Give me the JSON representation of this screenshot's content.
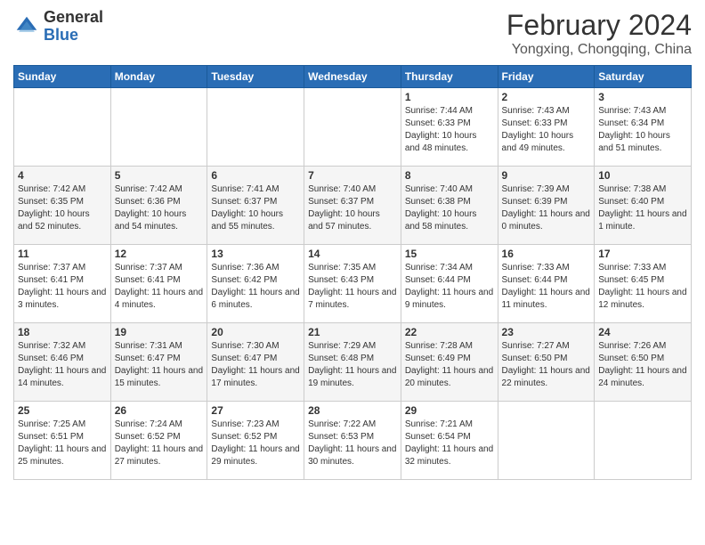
{
  "logo": {
    "general": "General",
    "blue": "Blue"
  },
  "title": "February 2024",
  "location": "Yongxing, Chongqing, China",
  "days_header": [
    "Sunday",
    "Monday",
    "Tuesday",
    "Wednesday",
    "Thursday",
    "Friday",
    "Saturday"
  ],
  "weeks": [
    [
      {
        "day": "",
        "info": ""
      },
      {
        "day": "",
        "info": ""
      },
      {
        "day": "",
        "info": ""
      },
      {
        "day": "",
        "info": ""
      },
      {
        "day": "1",
        "info": "Sunrise: 7:44 AM\nSunset: 6:33 PM\nDaylight: 10 hours and 48 minutes."
      },
      {
        "day": "2",
        "info": "Sunrise: 7:43 AM\nSunset: 6:33 PM\nDaylight: 10 hours and 49 minutes."
      },
      {
        "day": "3",
        "info": "Sunrise: 7:43 AM\nSunset: 6:34 PM\nDaylight: 10 hours and 51 minutes."
      }
    ],
    [
      {
        "day": "4",
        "info": "Sunrise: 7:42 AM\nSunset: 6:35 PM\nDaylight: 10 hours and 52 minutes."
      },
      {
        "day": "5",
        "info": "Sunrise: 7:42 AM\nSunset: 6:36 PM\nDaylight: 10 hours and 54 minutes."
      },
      {
        "day": "6",
        "info": "Sunrise: 7:41 AM\nSunset: 6:37 PM\nDaylight: 10 hours and 55 minutes."
      },
      {
        "day": "7",
        "info": "Sunrise: 7:40 AM\nSunset: 6:37 PM\nDaylight: 10 hours and 57 minutes."
      },
      {
        "day": "8",
        "info": "Sunrise: 7:40 AM\nSunset: 6:38 PM\nDaylight: 10 hours and 58 minutes."
      },
      {
        "day": "9",
        "info": "Sunrise: 7:39 AM\nSunset: 6:39 PM\nDaylight: 11 hours and 0 minutes."
      },
      {
        "day": "10",
        "info": "Sunrise: 7:38 AM\nSunset: 6:40 PM\nDaylight: 11 hours and 1 minute."
      }
    ],
    [
      {
        "day": "11",
        "info": "Sunrise: 7:37 AM\nSunset: 6:41 PM\nDaylight: 11 hours and 3 minutes."
      },
      {
        "day": "12",
        "info": "Sunrise: 7:37 AM\nSunset: 6:41 PM\nDaylight: 11 hours and 4 minutes."
      },
      {
        "day": "13",
        "info": "Sunrise: 7:36 AM\nSunset: 6:42 PM\nDaylight: 11 hours and 6 minutes."
      },
      {
        "day": "14",
        "info": "Sunrise: 7:35 AM\nSunset: 6:43 PM\nDaylight: 11 hours and 7 minutes."
      },
      {
        "day": "15",
        "info": "Sunrise: 7:34 AM\nSunset: 6:44 PM\nDaylight: 11 hours and 9 minutes."
      },
      {
        "day": "16",
        "info": "Sunrise: 7:33 AM\nSunset: 6:44 PM\nDaylight: 11 hours and 11 minutes."
      },
      {
        "day": "17",
        "info": "Sunrise: 7:33 AM\nSunset: 6:45 PM\nDaylight: 11 hours and 12 minutes."
      }
    ],
    [
      {
        "day": "18",
        "info": "Sunrise: 7:32 AM\nSunset: 6:46 PM\nDaylight: 11 hours and 14 minutes."
      },
      {
        "day": "19",
        "info": "Sunrise: 7:31 AM\nSunset: 6:47 PM\nDaylight: 11 hours and 15 minutes."
      },
      {
        "day": "20",
        "info": "Sunrise: 7:30 AM\nSunset: 6:47 PM\nDaylight: 11 hours and 17 minutes."
      },
      {
        "day": "21",
        "info": "Sunrise: 7:29 AM\nSunset: 6:48 PM\nDaylight: 11 hours and 19 minutes."
      },
      {
        "day": "22",
        "info": "Sunrise: 7:28 AM\nSunset: 6:49 PM\nDaylight: 11 hours and 20 minutes."
      },
      {
        "day": "23",
        "info": "Sunrise: 7:27 AM\nSunset: 6:50 PM\nDaylight: 11 hours and 22 minutes."
      },
      {
        "day": "24",
        "info": "Sunrise: 7:26 AM\nSunset: 6:50 PM\nDaylight: 11 hours and 24 minutes."
      }
    ],
    [
      {
        "day": "25",
        "info": "Sunrise: 7:25 AM\nSunset: 6:51 PM\nDaylight: 11 hours and 25 minutes."
      },
      {
        "day": "26",
        "info": "Sunrise: 7:24 AM\nSunset: 6:52 PM\nDaylight: 11 hours and 27 minutes."
      },
      {
        "day": "27",
        "info": "Sunrise: 7:23 AM\nSunset: 6:52 PM\nDaylight: 11 hours and 29 minutes."
      },
      {
        "day": "28",
        "info": "Sunrise: 7:22 AM\nSunset: 6:53 PM\nDaylight: 11 hours and 30 minutes."
      },
      {
        "day": "29",
        "info": "Sunrise: 7:21 AM\nSunset: 6:54 PM\nDaylight: 11 hours and 32 minutes."
      },
      {
        "day": "",
        "info": ""
      },
      {
        "day": "",
        "info": ""
      }
    ]
  ]
}
